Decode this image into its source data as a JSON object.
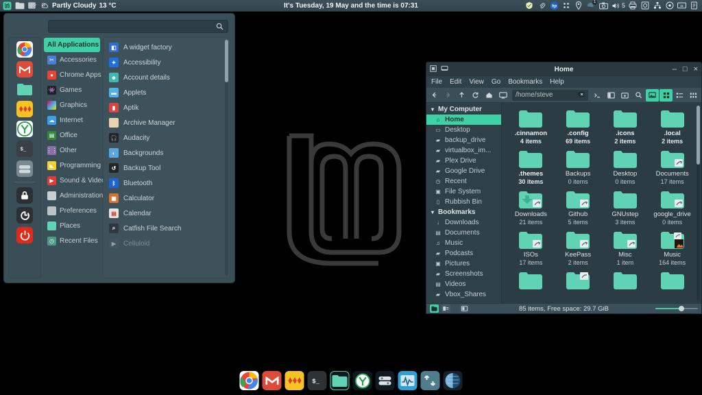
{
  "panel": {
    "left_items": [
      {
        "name": "mint-menu-button",
        "label": "Menu",
        "icon": "mint-logo-icon"
      },
      {
        "name": "panel-files-launcher",
        "label": "Files",
        "icon": "folder-icon"
      },
      {
        "name": "panel-texteditor-launcher",
        "label": "Text Editor",
        "icon": "text-editor-icon"
      }
    ],
    "weather": {
      "condition": "Partly Cloudy",
      "temperature": "13 °C",
      "icon": "partly-cloudy-icon"
    },
    "clock": "It's Tuesday, 19 May and the time is 07:31",
    "tray_items": [
      {
        "name": "tray-shield",
        "icon": "shield-icon"
      },
      {
        "name": "tray-clipboard",
        "icon": "paperclip-icon"
      },
      {
        "name": "tray-hp",
        "icon": "hp-printer-icon",
        "label": "hp"
      },
      {
        "name": "tray-dots",
        "icon": "grid-dots-icon"
      },
      {
        "name": "tray-location",
        "icon": "location-pin-icon"
      },
      {
        "name": "tray-update",
        "icon": "update-shield-icon",
        "badge": "1"
      },
      {
        "name": "tray-screenshot",
        "icon": "camera-icon"
      },
      {
        "name": "tray-volume",
        "icon": "speaker-icon",
        "label": "5"
      },
      {
        "name": "tray-printer",
        "icon": "printer-icon"
      },
      {
        "name": "tray-disk",
        "icon": "disk-icon"
      },
      {
        "name": "tray-network",
        "icon": "network-icon"
      },
      {
        "name": "tray-settings",
        "icon": "gear-icon"
      },
      {
        "name": "tray-display",
        "icon": "display-sleep-icon"
      },
      {
        "name": "tray-notes",
        "icon": "notes-icon"
      }
    ]
  },
  "menu": {
    "search": {
      "placeholder": "",
      "value": "",
      "icon": "search-icon"
    },
    "favorites": [
      {
        "name": "fav-chrome",
        "label": "Google Chrome",
        "icon": "chrome-icon",
        "color": "#f2f2f2"
      },
      {
        "name": "fav-gmail",
        "label": "Gmail",
        "icon": "gmail-icon",
        "color": "#de4233"
      },
      {
        "name": "fav-files",
        "label": "Files",
        "icon": "folder-icon",
        "color": "#5fd3b4"
      },
      {
        "name": "fav-cards",
        "label": "Solitaire",
        "icon": "cards-icon",
        "color": "#f5c13b"
      },
      {
        "name": "fav-yandex",
        "label": "Yandex",
        "icon": "green-circle-icon",
        "color": "#ffffff"
      },
      {
        "name": "fav-terminal",
        "label": "Terminal",
        "icon": "terminal-icon",
        "color": "#3a3f44"
      },
      {
        "name": "fav-software",
        "label": "Software Manager",
        "icon": "software-icon",
        "color": "#6d7c84"
      },
      {
        "name": "fav-lock",
        "label": "Lock Screen",
        "icon": "lock-icon",
        "color": "#2c3136"
      },
      {
        "name": "fav-logout",
        "label": "Log Out",
        "icon": "logout-icon",
        "color": "#2c3136"
      },
      {
        "name": "fav-shutdown",
        "label": "Shut Down",
        "icon": "power-icon",
        "color": "#e02a1c"
      }
    ],
    "categories": [
      {
        "label": "All Applications",
        "icon": "all-apps-icon",
        "color": "#3fd0a8",
        "active": true
      },
      {
        "label": "Accessories",
        "icon": "accessories-icon",
        "color": "#4a7fd4"
      },
      {
        "label": "Chrome Apps",
        "icon": "chrome-icon",
        "color": "#e8e8e8"
      },
      {
        "label": "Games",
        "icon": "games-icon",
        "color": "#1d2226"
      },
      {
        "label": "Graphics",
        "icon": "graphics-icon",
        "color": "#a04fc0"
      },
      {
        "label": "Internet",
        "icon": "internet-icon",
        "color": "#3ba0e8"
      },
      {
        "label": "Office",
        "icon": "office-icon",
        "color": "#2f8a3f"
      },
      {
        "label": "Other",
        "icon": "other-icon",
        "color": "#8a6fa8"
      },
      {
        "label": "Programming",
        "icon": "programming-icon",
        "color": "#f2d230"
      },
      {
        "label": "Sound & Video",
        "icon": "sound-video-icon",
        "color": "#e03a3a"
      },
      {
        "label": "Administration",
        "icon": "administration-icon",
        "color": "#c8cfd3"
      },
      {
        "label": "Preferences",
        "icon": "preferences-icon",
        "color": "#b9c3c8"
      },
      {
        "label": "Places",
        "icon": "folder-icon",
        "color": "#5fd3b4"
      },
      {
        "label": "Recent Files",
        "icon": "recent-icon",
        "color": "#4c9b86"
      }
    ],
    "applications": [
      {
        "label": "A widget factory",
        "icon": "widget-factory-icon",
        "color": "#2f6fd0"
      },
      {
        "label": "Accessibility",
        "icon": "accessibility-icon",
        "color": "#1f6fe0"
      },
      {
        "label": "Account details",
        "icon": "account-details-icon",
        "color": "#3fb8b0"
      },
      {
        "label": "Applets",
        "icon": "applets-icon",
        "color": "#4fb3e8"
      },
      {
        "label": "Aptik",
        "icon": "aptik-icon",
        "color": "#d84343"
      },
      {
        "label": "Archive Manager",
        "icon": "archive-manager-icon",
        "color": "#e8d3ae"
      },
      {
        "label": "Audacity",
        "icon": "audacity-icon",
        "color": "#23252b"
      },
      {
        "label": "Backgrounds",
        "icon": "backgrounds-icon",
        "color": "#5ba8e0"
      },
      {
        "label": "Backup Tool",
        "icon": "backup-tool-icon",
        "color": "#22262b"
      },
      {
        "label": "Bluetooth",
        "icon": "bluetooth-icon",
        "color": "#1f63d8"
      },
      {
        "label": "Calculator",
        "icon": "calculator-icon",
        "color": "#d8732a"
      },
      {
        "label": "Calendar",
        "icon": "calendar-icon",
        "color": "#e8e4e0"
      },
      {
        "label": "Catfish File Search",
        "icon": "catfish-icon",
        "color": "#2e3840"
      },
      {
        "label": "Celluloid",
        "icon": "celluloid-icon",
        "color": "#4a5a68"
      }
    ]
  },
  "nemo": {
    "title": "Home",
    "window_buttons": {
      "minimize": "–",
      "maximize": "□",
      "close": "×"
    },
    "menus": [
      "File",
      "Edit",
      "View",
      "Go",
      "Bookmarks",
      "Help"
    ],
    "toolbar": {
      "path": "/home/steve",
      "buttons": [
        {
          "name": "back-button",
          "icon": "arrow-left-icon",
          "state": "enabled"
        },
        {
          "name": "forward-button",
          "icon": "arrow-right-icon",
          "state": "disabled"
        },
        {
          "name": "up-button",
          "icon": "arrow-up-icon",
          "state": "enabled"
        },
        {
          "name": "reload-button",
          "icon": "reload-icon",
          "state": "enabled"
        },
        {
          "name": "home-button",
          "icon": "home-icon",
          "state": "enabled"
        },
        {
          "name": "computer-button",
          "icon": "computer-icon",
          "state": "enabled"
        }
      ],
      "right_buttons": [
        {
          "name": "open-terminal-button",
          "icon": "terminal-icon",
          "state": "enabled"
        },
        {
          "name": "split-view-button",
          "icon": "split-view-icon",
          "state": "enabled"
        },
        {
          "name": "new-folder-button",
          "icon": "new-folder-icon",
          "state": "enabled"
        },
        {
          "name": "search-button",
          "icon": "search-icon",
          "state": "enabled"
        },
        {
          "name": "thumbnail-toggle-button",
          "icon": "image-icon",
          "state": "active"
        },
        {
          "name": "icon-view-button",
          "icon": "grid-view-icon",
          "state": "active"
        },
        {
          "name": "list-view-button",
          "icon": "list-view-icon",
          "state": "enabled"
        },
        {
          "name": "compact-view-button",
          "icon": "compact-view-icon",
          "state": "enabled"
        }
      ]
    },
    "sidebar": [
      {
        "type": "header",
        "label": "My Computer",
        "icon": "chevron-down-icon"
      },
      {
        "type": "item",
        "label": "Home",
        "icon": "home-icon",
        "active": true
      },
      {
        "type": "item",
        "label": "Desktop",
        "icon": "desktop-icon"
      },
      {
        "type": "item",
        "label": "backup_drive",
        "icon": "folder-icon"
      },
      {
        "type": "item",
        "label": "virtualbox_im...",
        "icon": "folder-icon"
      },
      {
        "type": "item",
        "label": "Plex Drive",
        "icon": "folder-icon"
      },
      {
        "type": "item",
        "label": "Google Drive",
        "icon": "folder-icon"
      },
      {
        "type": "item",
        "label": "Recent",
        "icon": "recent-icon"
      },
      {
        "type": "item",
        "label": "File System",
        "icon": "filesystem-icon"
      },
      {
        "type": "item",
        "label": "Rubbish Bin",
        "icon": "trash-icon"
      },
      {
        "type": "header",
        "label": "Bookmarks",
        "icon": "chevron-down-icon"
      },
      {
        "type": "item",
        "label": "Downloads",
        "icon": "download-icon"
      },
      {
        "type": "item",
        "label": "Documents",
        "icon": "document-icon"
      },
      {
        "type": "item",
        "label": "Music",
        "icon": "music-note-icon"
      },
      {
        "type": "item",
        "label": "Podcasts",
        "icon": "folder-icon"
      },
      {
        "type": "item",
        "label": "Pictures",
        "icon": "camera-icon"
      },
      {
        "type": "item",
        "label": "Screenshots",
        "icon": "folder-icon"
      },
      {
        "type": "item",
        "label": "Videos",
        "icon": "video-icon"
      },
      {
        "type": "item",
        "label": "Vbox_Shares",
        "icon": "folder-icon"
      }
    ],
    "files": [
      {
        "name": ".cinnamon",
        "items": "4 items",
        "hidden": true,
        "emblem": "none"
      },
      {
        "name": ".config",
        "items": "69 items",
        "hidden": true,
        "emblem": "none"
      },
      {
        "name": ".icons",
        "items": "2 items",
        "hidden": true,
        "emblem": "none"
      },
      {
        "name": ".local",
        "items": "2 items",
        "hidden": true,
        "emblem": "none"
      },
      {
        "name": ".themes",
        "items": "30 items",
        "hidden": true,
        "emblem": "none"
      },
      {
        "name": "Backups",
        "items": "0 items",
        "hidden": false,
        "emblem": "none"
      },
      {
        "name": "Desktop",
        "items": "0 items",
        "hidden": false,
        "emblem": "none"
      },
      {
        "name": "Documents",
        "items": "17 items",
        "hidden": false,
        "emblem": "symlink"
      },
      {
        "name": "Downloads",
        "items": "21 items",
        "hidden": false,
        "emblem": "symlink"
      },
      {
        "name": "Github",
        "items": "5 items",
        "hidden": false,
        "emblem": "symlink"
      },
      {
        "name": "GNUstep",
        "items": "3 items",
        "hidden": false,
        "emblem": "none"
      },
      {
        "name": "google_drive",
        "items": "0 items",
        "hidden": false,
        "emblem": "symlink"
      },
      {
        "name": "ISOs",
        "items": "17 items",
        "hidden": false,
        "emblem": "symlink"
      },
      {
        "name": "KeePass",
        "items": "2 items",
        "hidden": false,
        "emblem": "symlink"
      },
      {
        "name": "Misc",
        "items": "1 item",
        "hidden": false,
        "emblem": "symlink"
      },
      {
        "name": "Music",
        "items": "164 items",
        "hidden": false,
        "emblem": "thumbnail"
      }
    ],
    "status": {
      "text": "85 items, Free space: 29.7 GiB",
      "buttons": [
        {
          "name": "icon-view-toggle",
          "icon": "folder-icon",
          "state": "active"
        },
        {
          "name": "tree-view-toggle",
          "icon": "tree-icon",
          "state": "enabled"
        },
        {
          "name": "extra-pane-toggle",
          "icon": "pane-icon",
          "state": "enabled"
        }
      ],
      "zoom_level": "55"
    }
  },
  "dock": [
    {
      "name": "dock-chrome",
      "label": "Google Chrome",
      "icon": "chrome-icon",
      "color": "#f4f4f4",
      "running": false
    },
    {
      "name": "dock-gmail",
      "label": "Gmail",
      "icon": "gmail-icon",
      "color": "#de4233",
      "running": false
    },
    {
      "name": "dock-cards",
      "label": "Solitaire",
      "icon": "cards-icon",
      "color": "#f5c13b",
      "running": false
    },
    {
      "name": "dock-terminal",
      "label": "Terminal",
      "icon": "terminal-icon",
      "color": "#2d3237",
      "running": false
    },
    {
      "name": "dock-files",
      "label": "Files",
      "icon": "folder-icon",
      "color": "#0f1a1f",
      "running": true
    },
    {
      "name": "dock-yandex",
      "label": "Yandex Disk",
      "icon": "green-circle-icon",
      "color": "#0f1a1f",
      "running": false
    },
    {
      "name": "dock-software",
      "label": "Software Manager",
      "icon": "software-icon",
      "color": "#0f1a1f",
      "running": false
    },
    {
      "name": "dock-monitor",
      "label": "System Monitor",
      "icon": "system-monitor-icon",
      "color": "#2f9fd8",
      "running": false
    },
    {
      "name": "dock-network",
      "label": "Network Monitor",
      "icon": "network-updown-icon",
      "color": "#4f7d8c",
      "running": false
    },
    {
      "name": "dock-blue-app",
      "label": "Disk Usage",
      "icon": "blue-sphere-icon",
      "color": "#16212a",
      "running": false
    }
  ],
  "wallpaper": {
    "logo": "linux-mint-logo",
    "background_color": "#000000"
  }
}
